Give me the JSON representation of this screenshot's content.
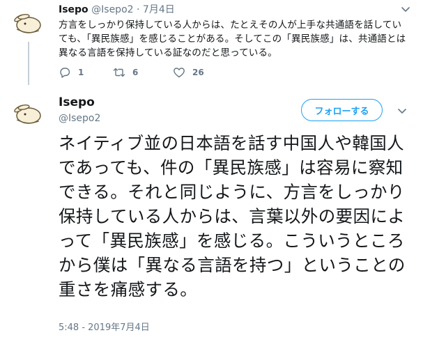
{
  "reply_tweet": {
    "author_name": "Isepo",
    "author_handle": "@Isepo2",
    "separator": "·",
    "timestamp": "7月4日",
    "text": "方言をしっかり保持している人からは、たとえその人が上手な共通語を話していても、「異民族感」を感じることがある。そしてこの「異民族感」は、共通語とは異なる言語を保持している証なのだと思っている。",
    "reply_icon": "reply-icon",
    "reply_count": "1",
    "retweet_icon": "retweet-icon",
    "retweet_count": "6",
    "like_icon": "heart-icon",
    "like_count": "26",
    "menu_icon": "chevron-down-icon"
  },
  "main_tweet": {
    "author_name": "Isepo",
    "author_handle": "@Isepo2",
    "follow_label": "フォローする",
    "menu_icon": "chevron-down-icon",
    "text": "ネイティブ並の日本語を話す中国人や韓国人であっても、件の「異民族感」は容易に察知できる。それと同じように、方言をしっかり保持している人からは、言葉以外の要因によって「異民族感」を感じる。こういうところから僕は「異なる言語を持つ」ということの重さを痛感する。",
    "timestamp": "5:48 - 2019年7月4日"
  },
  "colors": {
    "accent": "#1da1f2",
    "secondary_text": "#657786",
    "primary_text": "#14171a",
    "thread_line": "#c4cfd6"
  }
}
